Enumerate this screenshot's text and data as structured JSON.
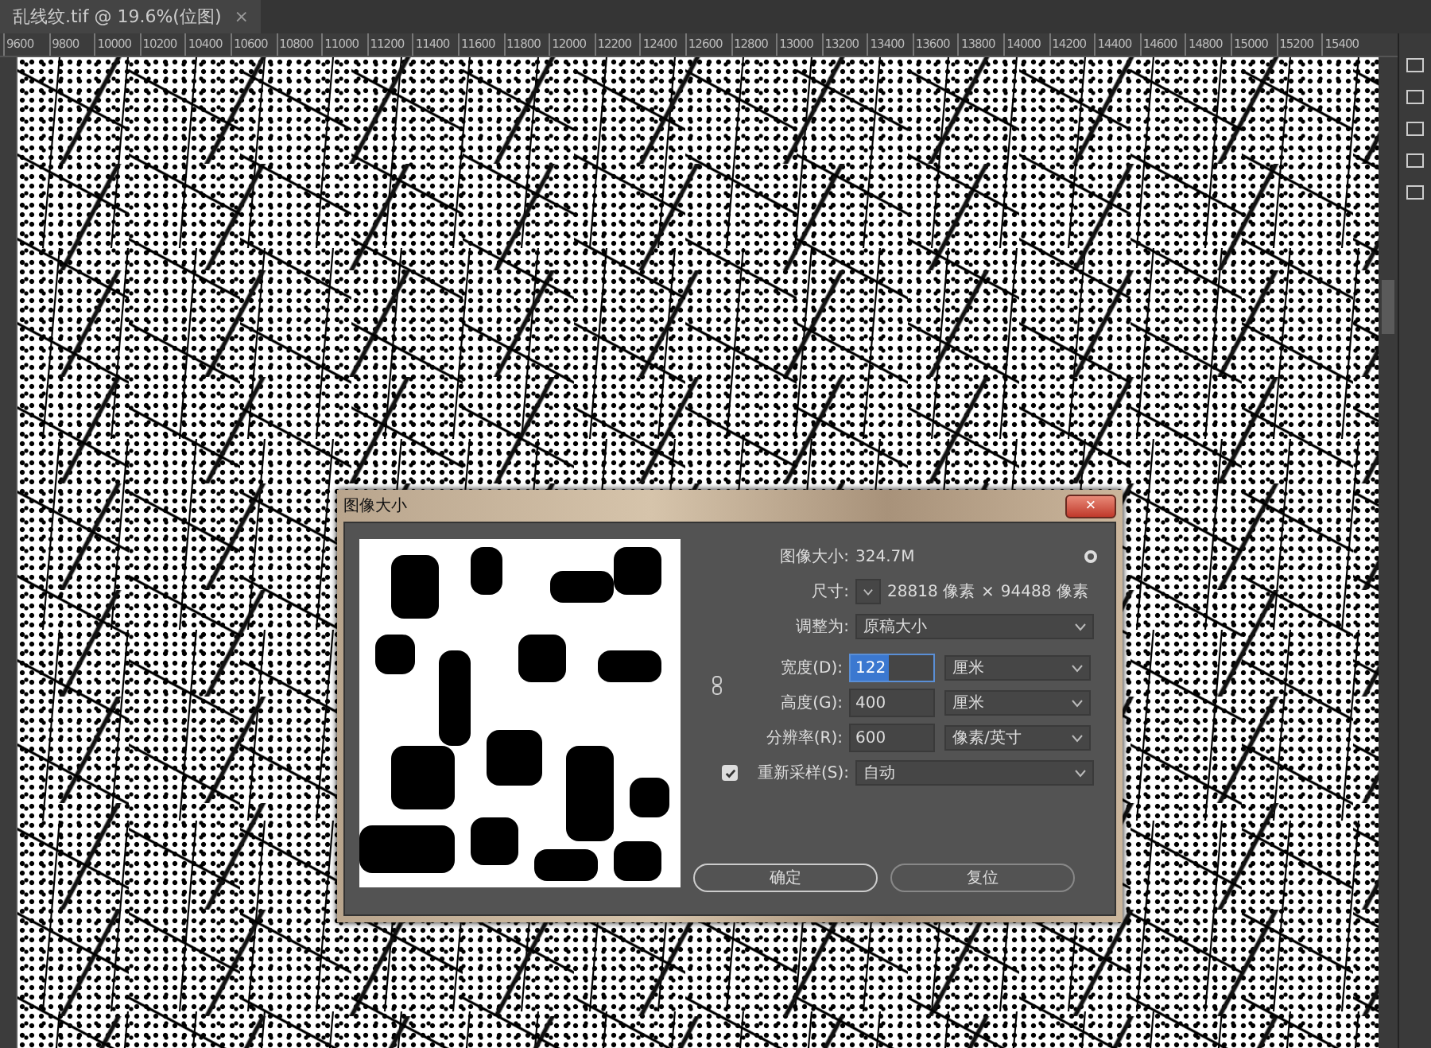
{
  "document_tab": {
    "title": "乱线纹.tif @ 19.6%(位图)",
    "close": "×"
  },
  "ruler": {
    "labels": [
      "9600",
      "9800",
      "10000",
      "10200",
      "10400",
      "10600",
      "10800",
      "11000",
      "11200",
      "11400",
      "11600",
      "11800",
      "12000",
      "12200",
      "12400",
      "12600",
      "12800",
      "13000",
      "13200",
      "13400",
      "13600",
      "13800",
      "14000",
      "14200",
      "14400",
      "14600",
      "14800",
      "15000",
      "15200",
      "15400"
    ]
  },
  "dialog": {
    "title": "图像大小",
    "close": "×",
    "image_size": {
      "label": "图像大小:",
      "value": "324.7M"
    },
    "dimensions": {
      "label": "尺寸:",
      "width": "28818 像素",
      "times": "×",
      "height": "94488 像素"
    },
    "fit_to": {
      "label": "调整为:",
      "value": "原稿大小"
    },
    "fields": [
      {
        "label": "宽度(D):",
        "value": "122",
        "unit": "厘米",
        "selected": true
      },
      {
        "label": "高度(G):",
        "value": "400",
        "unit": "厘米",
        "selected": false
      },
      {
        "label": "分辨率(R):",
        "value": "600",
        "unit": "像素/英寸",
        "selected": false
      }
    ],
    "resample": {
      "label": "重新采样(S):",
      "checked": true,
      "value": "自动"
    },
    "buttons": [
      {
        "label": "确定",
        "kind": "primary"
      },
      {
        "label": "复位",
        "kind": "secondary"
      }
    ]
  }
}
